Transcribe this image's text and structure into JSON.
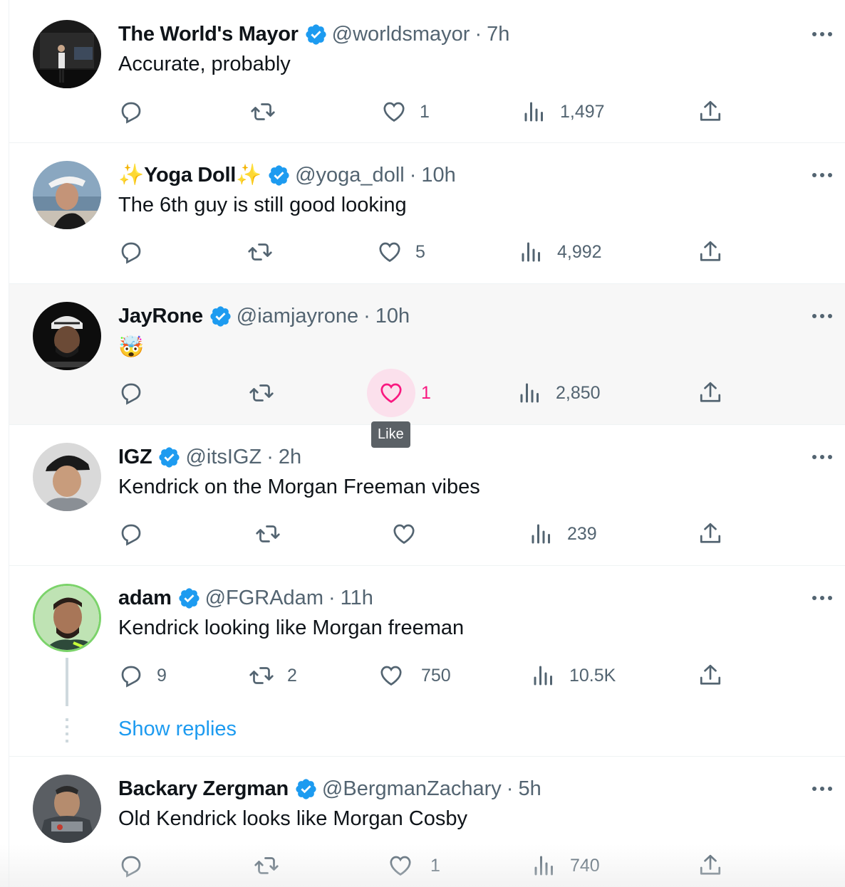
{
  "tweets": [
    {
      "name": "The World's Mayor",
      "handle": "@worldsmayor",
      "dot": "·",
      "time": "7h",
      "text": "Accurate, probably",
      "replies": "",
      "retweets": "",
      "likes": "1",
      "views": "1,497"
    },
    {
      "name_prefix": "✨",
      "name": "Yoga Doll",
      "name_suffix": "✨",
      "handle": "@yoga_doll",
      "dot": "·",
      "time": "10h",
      "text": "The 6th guy is still good looking",
      "replies": "",
      "retweets": "",
      "likes": "5",
      "views": "4,992"
    },
    {
      "name": "JayRone",
      "handle": "@iamjayrone",
      "dot": "·",
      "time": "10h",
      "text": "🤯",
      "replies": "",
      "retweets": "",
      "likes": "1",
      "views": "2,850",
      "tooltip": "Like"
    },
    {
      "name": "IGZ",
      "handle": "@itsIGZ",
      "dot": "·",
      "time": "2h",
      "text": "Kendrick on the Morgan Freeman vibes",
      "replies": "",
      "retweets": "",
      "likes": "",
      "views": "239"
    },
    {
      "name": "adam",
      "handle": "@FGRAdam",
      "dot": "·",
      "time": "11h",
      "text": "Kendrick looking like Morgan freeman",
      "replies": "9",
      "retweets": "2",
      "likes": "750",
      "views": "10.5K",
      "show_replies": "Show replies"
    },
    {
      "name": "Backary Zergman",
      "handle": "@BergmanZachary",
      "dot": "·",
      "time": "5h",
      "text": "Old Kendrick looks like Morgan Cosby",
      "replies": "",
      "retweets": "",
      "likes": "1",
      "views": "740"
    }
  ],
  "colors": {
    "verified": "#1d9bf0",
    "like_active": "#f91880",
    "link": "#1d9bf0",
    "muted": "#536471"
  },
  "icons": {
    "reply": "reply-icon",
    "retweet": "retweet-icon",
    "like": "heart-icon",
    "views": "views-chart-icon",
    "share": "share-icon",
    "more": "more-dots-icon",
    "verified": "verified-badge-icon"
  }
}
